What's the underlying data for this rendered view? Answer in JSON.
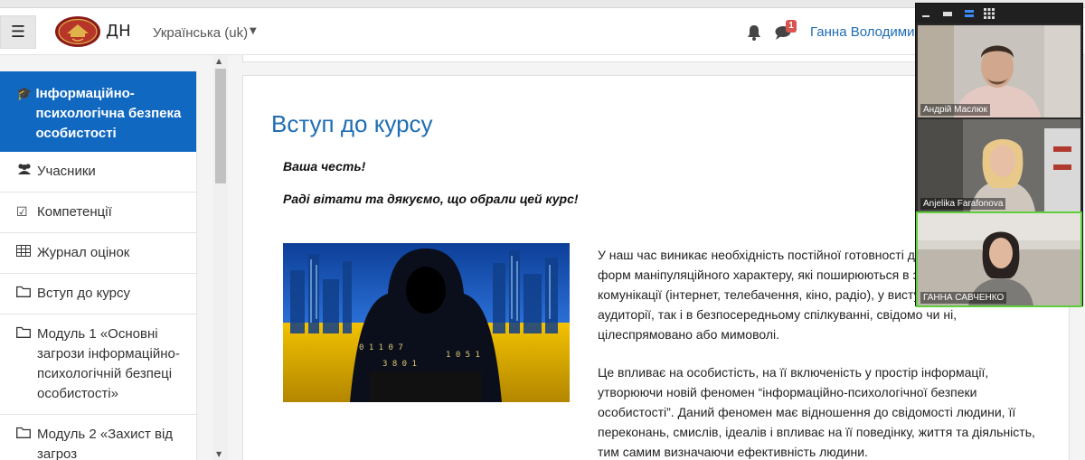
{
  "header": {
    "site_name": "ДН",
    "language": "Українська (uk)",
    "message_count": "1",
    "user_name": "Ганна Володимир"
  },
  "sidebar": {
    "active": {
      "icon": "graduation-cap-icon",
      "label": "Інформаційно-психологічна безпека особистості"
    },
    "items": [
      {
        "icon": "users-icon",
        "label": "Учасники"
      },
      {
        "icon": "check-square-icon",
        "label": "Компетенції"
      },
      {
        "icon": "table-icon",
        "label": "Журнал оцінок"
      },
      {
        "icon": "folder-icon",
        "label": "Вступ до курсу"
      },
      {
        "icon": "folder-icon",
        "label": "Модуль 1 «Основні загрози інформаційно-психологічній безпеці особистості»"
      },
      {
        "icon": "folder-icon",
        "label": "Модуль 2 «Захист від загроз"
      }
    ]
  },
  "content": {
    "title": "Вступ до курсу",
    "greeting_1": "Ваша честь!",
    "greeting_2": "Раді вітати та дякуємо, що обрали цей курс!",
    "paragraph_1": "У наш час виникає необхідність постійної готовності до різноманітних форм маніпуляційного характеру, які поширюються в засобах масової комунікації (інтернет, телебачення, кіно, радіо), у виступах у масовій аудиторії, так і в безпосередньому спілкуванні, свідомо чи ні, цілеспрямовано або мимоволі.",
    "paragraph_2": "Це впливає на особистість, на її включеність у простір інформації, утворюючи новій феномен “інформаційно-психологічної безпеки особистості”. Даний феномен має відношення до свідомості людини, її переконань, смислів, ідеалів і впливає на її поведінку, життя та діяльність, тим самим визначаючи ефективність людини."
  },
  "video_call": {
    "participants": [
      {
        "name": "Андрій Маслюк",
        "speaking": false
      },
      {
        "name": "Anjelika Farafonova",
        "speaking": false
      },
      {
        "name": "ГАННА САВЧЕНКО",
        "speaking": true
      }
    ]
  },
  "colors": {
    "accent": "#1168c0",
    "link": "#1f6db4",
    "badge": "#d9534f",
    "flag_blue": "#1f5fbf",
    "flag_yellow": "#f2c200"
  }
}
